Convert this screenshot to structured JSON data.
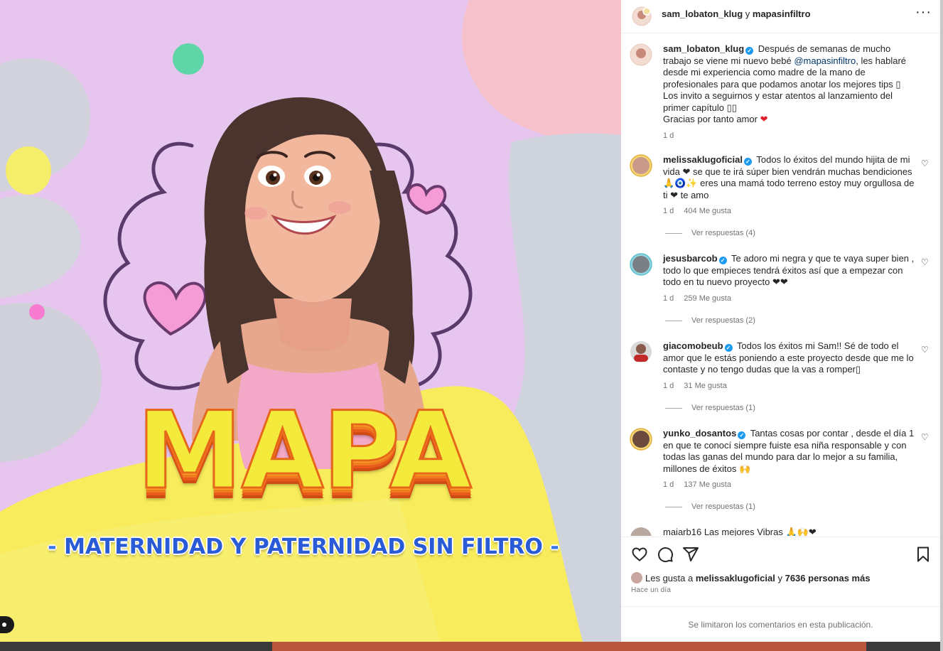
{
  "media": {
    "title": "MAPA",
    "subtitle": "MATERNIDAD Y PATERNIDAD SIN FILTRO",
    "dash": "-"
  },
  "header": {
    "user1": "sam_lobaton_klug",
    "conj": "y",
    "user2": "mapasinfiltro",
    "more": "···"
  },
  "caption": {
    "user": "sam_lobaton_klug",
    "text_a": "Después de semanas de mucho trabajo se viene mi nuevo bebé",
    "mention": "@mapasinfiltro",
    "text_b": ", les hablaré desde mi experiencia como madre de la mano de profesionales para que podamos anotar los mejores tips ▯",
    "line2": "Los invito a seguirnos y estar atentos al lanzamiento del primer capítulo ▯▯",
    "line3": "Gracias por tanto amor",
    "heart": "❤",
    "time": "1 d"
  },
  "comments": [
    {
      "user": "melissaklugoficial",
      "text": "Todos lo éxitos del mundo hijita de mi vida ❤ se que te irá súper bien vendrán muchas bendiciones 🙏🧿✨ eres una mamá todo terreno estoy muy orgullosa de ti ❤ te amo",
      "time": "1 d",
      "likes": "404 Me gusta",
      "replies": "Ver respuestas (4)"
    },
    {
      "user": "jesusbarcob",
      "text": "Te adoro mi negra y que te vaya super bien , todo lo que empieces tendrá éxitos así que a empezar con todo en tu nuevo proyecto ❤❤",
      "time": "1 d",
      "likes": "259 Me gusta",
      "replies": "Ver respuestas (2)"
    },
    {
      "user": "giacomobeub",
      "text": "Todos los éxitos mi Sam!! Sé de todo el amor que le estás poniendo a este proyecto desde que me lo contaste y no tengo dudas que la vas a romper▯",
      "time": "1 d",
      "likes": "31 Me gusta",
      "replies": "Ver respuestas (1)"
    },
    {
      "user": "yunko_dosantos",
      "text": "Tantas cosas por contar , desde el día 1 en que te conocí siempre fuiste esa niña responsable y con todas las ganas del mundo para dar lo mejor a su familia, millones de éxitos 🙌",
      "time": "1 d",
      "likes": "137 Me gusta",
      "replies": "Ver respuestas (1)"
    },
    {
      "user": "maiarb16",
      "text": "Las mejores Vibras 🙏🙌❤",
      "time": "",
      "likes": "",
      "replies": ""
    }
  ],
  "likes": {
    "prefix": "Les gusta a",
    "user": "melissaklugoficial",
    "conj": "y",
    "others": "7636 personas más",
    "time": "Hace un día"
  },
  "limited_text": "Se limitaron los comentarios en esta publicación.",
  "icons": [
    "heart-icon",
    "comment-icon",
    "share-icon",
    "bookmark-icon",
    "more-icon",
    "verified-icon"
  ]
}
